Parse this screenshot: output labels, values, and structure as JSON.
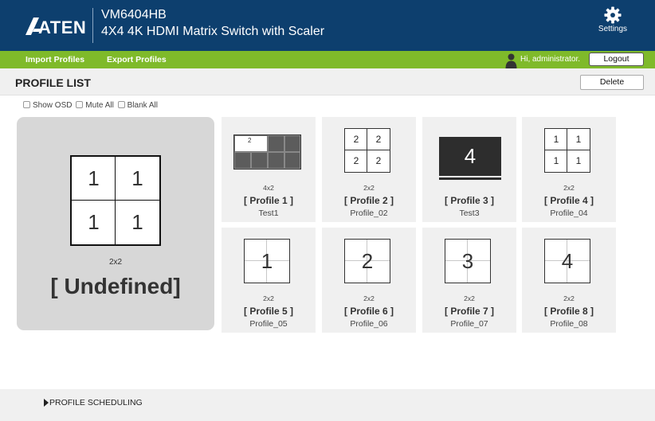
{
  "header": {
    "brand": "ATEN",
    "model": "VM6404HB",
    "product": "4X4 4K HDMI Matrix Switch with Scaler",
    "settings_label": "Settings"
  },
  "menu": {
    "import_label": "Import Profiles",
    "export_label": "Export Profiles",
    "greeting": "Hi, administrator.",
    "logout_label": "Logout"
  },
  "profile_list": {
    "title": "PROFILE LIST",
    "delete_label": "Delete"
  },
  "options": {
    "show_osd": "Show OSD",
    "mute_all": "Mute All",
    "blank_all": "Blank All"
  },
  "preview": {
    "cells": [
      "1",
      "1",
      "1",
      "1"
    ],
    "layout": "2x2",
    "name": "[ Undefined]"
  },
  "profiles": [
    {
      "name": "[ Profile 1 ]",
      "desc": "Test1",
      "layout": "4x2",
      "preview": "video-wall",
      "active_cell_label": "2"
    },
    {
      "name": "[ Profile 2 ]",
      "desc": "Profile_02",
      "layout": "2x2",
      "preview": "quad",
      "cells": [
        "2",
        "2",
        "2",
        "2"
      ]
    },
    {
      "name": "[ Profile 3 ]",
      "desc": "Test3",
      "layout": "",
      "preview": "single-display",
      "number": "4"
    },
    {
      "name": "[ Profile 4 ]",
      "desc": "Profile_04",
      "layout": "2x2",
      "preview": "quad",
      "cells": [
        "1",
        "1",
        "1",
        "1"
      ]
    },
    {
      "name": "[ Profile 5 ]",
      "desc": "Profile_05",
      "layout": "2x2",
      "preview": "single-grid",
      "number": "1"
    },
    {
      "name": "[ Profile 6 ]",
      "desc": "Profile_06",
      "layout": "2x2",
      "preview": "single-grid",
      "number": "2"
    },
    {
      "name": "[ Profile 7 ]",
      "desc": "Profile_07",
      "layout": "2x2",
      "preview": "single-grid",
      "number": "3"
    },
    {
      "name": "[ Profile 8 ]",
      "desc": "Profile_08",
      "layout": "2x2",
      "preview": "single-grid",
      "number": "4"
    }
  ],
  "scheduling": {
    "label": "PROFILE SCHEDULING"
  },
  "colors": {
    "header_bg": "#0d3f6e",
    "menubar_bg": "#7fba2a",
    "card_bg": "#f0f0f0",
    "preview_bg": "#d7d7d7"
  }
}
